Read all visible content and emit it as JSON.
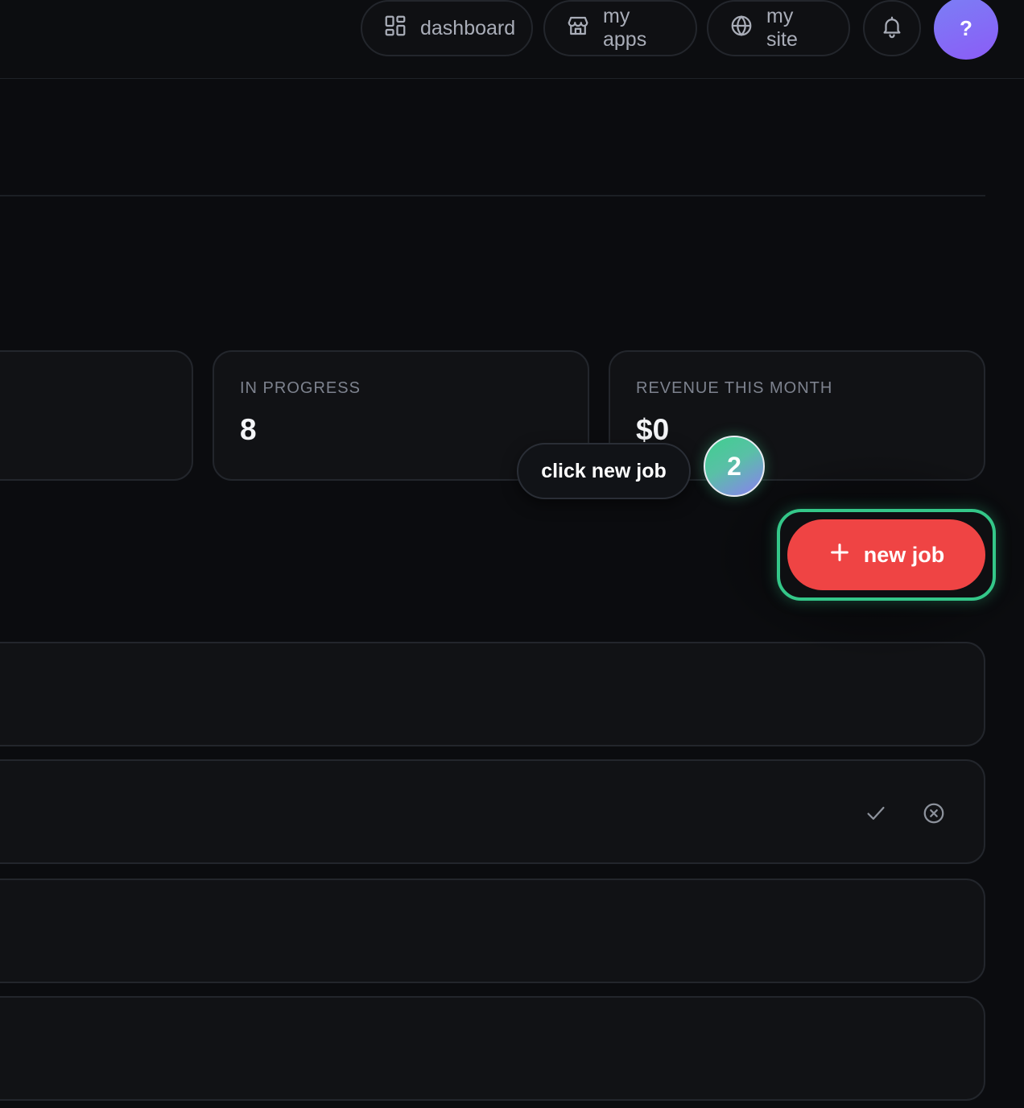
{
  "nav": {
    "dashboard_label": "dashboard",
    "dashboard_icon": "grid-icon",
    "apps_label": "my apps",
    "apps_icon": "storefront-icon",
    "site_label": "my site",
    "site_icon": "globe-icon",
    "notifications_icon": "bell-icon",
    "help_label": "?"
  },
  "stats": [
    {
      "label": "",
      "value": ""
    },
    {
      "label": "IN PROGRESS",
      "value": "8"
    },
    {
      "label": "REVENUE THIS MONTH",
      "value": "$0"
    }
  ],
  "guide": {
    "tooltip": "click new job",
    "step": "2"
  },
  "actions": {
    "new_job_label": "new job",
    "new_job_icon": "plus-icon"
  },
  "rows": {
    "approve_icon": "check-icon",
    "dismiss_icon": "circle-x-icon"
  },
  "colors": {
    "background": "#0b0c0f",
    "card": "#111215",
    "accent_red": "#ef4444",
    "highlight_green": "#34c789",
    "help_purple": "#8b5cf6"
  }
}
